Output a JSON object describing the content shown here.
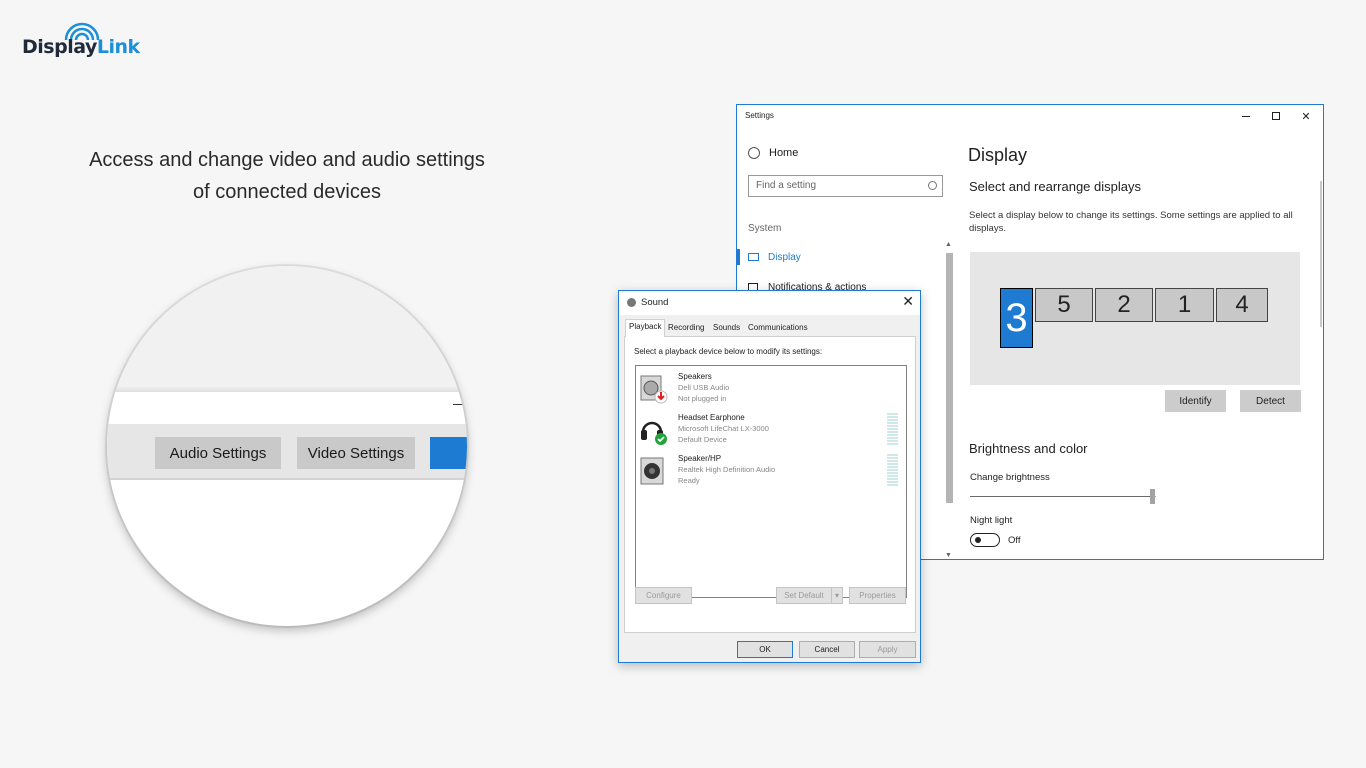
{
  "logo": {
    "part1": "Display",
    "part2": "Link"
  },
  "headline": {
    "line1": "Access and change video and audio settings",
    "line2": "of connected devices"
  },
  "magnifier": {
    "audio_button": "Audio Settings",
    "video_button": "Video Settings"
  },
  "settings": {
    "window_title": "Settings",
    "home": "Home",
    "search_placeholder": "Find a setting",
    "section": "System",
    "nav_display": "Display",
    "nav_notifications": "Notifications & actions",
    "page_title": "Display",
    "subtitle": "Select and rearrange displays",
    "description": "Select a display below to change its settings. Some settings are applied to all displays.",
    "displays": [
      "3",
      "5",
      "2",
      "1",
      "4"
    ],
    "identify": "Identify",
    "detect": "Detect",
    "brightness_heading": "Brightness and color",
    "change_brightness": "Change brightness",
    "brightness_level": 0.98,
    "night_light": "Night light",
    "night_light_state": "Off"
  },
  "sound": {
    "title": "Sound",
    "tabs": [
      "Playback",
      "Recording",
      "Sounds",
      "Communications"
    ],
    "active_tab": "Playback",
    "instruction": "Select a playback device below to modify its settings:",
    "devices": [
      {
        "name": "Speakers",
        "driver": "Dell USB Audio",
        "status": "Not plugged in"
      },
      {
        "name": "Headset Earphone",
        "driver": "Microsoft LifeChat LX-3000",
        "status": "Default Device"
      },
      {
        "name": "Speaker/HP",
        "driver": "Realtek High Definition Audio",
        "status": "Ready"
      }
    ],
    "configure": "Configure",
    "set_default": "Set Default",
    "properties": "Properties",
    "ok": "OK",
    "cancel": "Cancel",
    "apply": "Apply"
  },
  "colors": {
    "accent": "#1f7bd1",
    "brand_blue": "#1d8fd6"
  }
}
